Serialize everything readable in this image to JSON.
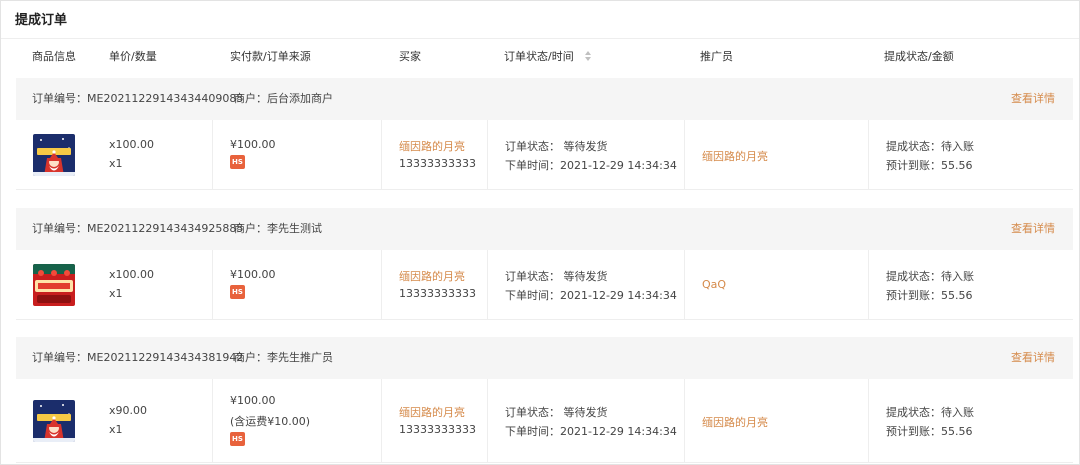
{
  "page": {
    "title": "提成订单"
  },
  "table": {
    "headers": {
      "product": "商品信息",
      "price_qty": "单价/数量",
      "paid_source": "实付款/订单来源",
      "buyer": "买家",
      "status_time": "订单状态/时间",
      "promoter": "推广员",
      "commission": "提成状态/金额"
    }
  },
  "labels": {
    "order_no": "订单编号：",
    "merchant": "商户：",
    "detail": "查看详情",
    "order_status": "订单状态：",
    "order_time": "下单时间：",
    "commission_status": "提成状态：",
    "expected": "预计到账："
  },
  "orders": [
    {
      "order_no": "ME20211229143434409085",
      "merchant": "后台添加商户",
      "thumb": "christmas-gift-thumbnail",
      "price": "x100.00",
      "qty": "x1",
      "paid": "¥100.00",
      "freight": "",
      "source_badge": "HS",
      "buyer_name": "缅因路的月亮",
      "buyer_phone": "13333333333",
      "status": "等待发货",
      "time": "2021-12-29 14:34:34",
      "promoter": "缅因路的月亮",
      "commission_status": "待入账",
      "commission_amount": "55.56"
    },
    {
      "order_no": "ME20211229143434925885",
      "merchant": "李先生测试",
      "thumb": "new-year-thumbnail",
      "price": "x100.00",
      "qty": "x1",
      "paid": "¥100.00",
      "freight": "",
      "source_badge": "HS",
      "buyer_name": "缅因路的月亮",
      "buyer_phone": "13333333333",
      "status": "等待发货",
      "time": "2021-12-29 14:34:34",
      "promoter": "QaQ",
      "commission_status": "待入账",
      "commission_amount": "55.56"
    },
    {
      "order_no": "ME20211229143434381942",
      "merchant": "李先生推广员",
      "thumb": "christmas-gift-thumbnail",
      "price": "x90.00",
      "qty": "x1",
      "paid": "¥100.00",
      "freight": "(含运费¥10.00)",
      "source_badge": "HS",
      "buyer_name": "缅因路的月亮",
      "buyer_phone": "13333333333",
      "status": "等待发货",
      "time": "2021-12-29 14:34:34",
      "promoter": "缅因路的月亮",
      "commission_status": "待入账",
      "commission_amount": "55.56"
    }
  ],
  "colors": {
    "accent": "#d58a4a",
    "badge": "#e8623c",
    "header_bg": "#f5f5f5"
  }
}
